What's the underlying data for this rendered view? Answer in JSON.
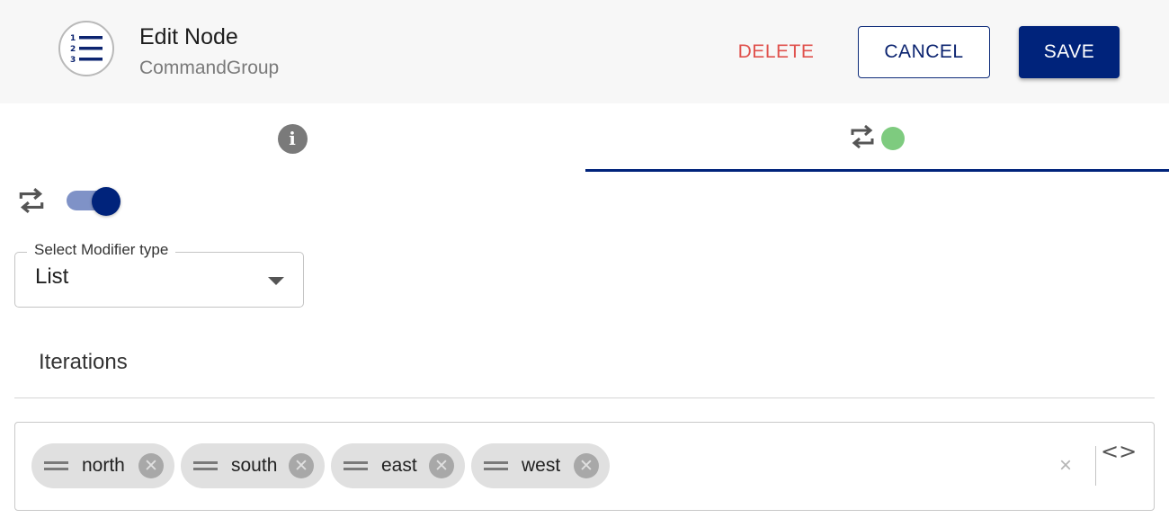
{
  "header": {
    "node_icon": "numbered-list-icon",
    "title": "Edit Node",
    "subtitle": "CommandGroup",
    "delete_label": "DELETE",
    "cancel_label": "CANCEL",
    "save_label": "SAVE"
  },
  "tabs": [
    {
      "icon": "info-icon",
      "selected": false
    },
    {
      "icon": "repeat-icon",
      "status": "green-dot",
      "selected": true
    }
  ],
  "modifier": {
    "toggle_icon": "repeat-icon",
    "enabled": true,
    "select_label": "Select Modifier type",
    "select_value": "List"
  },
  "iterations": {
    "label": "Iterations",
    "items": [
      {
        "label": "north"
      },
      {
        "label": "south"
      },
      {
        "label": "east"
      },
      {
        "label": "west"
      }
    ],
    "clear_symbol": "×",
    "code_symbol": "<>"
  },
  "colors": {
    "primary": "#00237b",
    "delete": "#e0524d",
    "status_green": "#7ecb7f",
    "toggle_track": "#7f92c7",
    "chip_bg": "#e0e0e0"
  }
}
